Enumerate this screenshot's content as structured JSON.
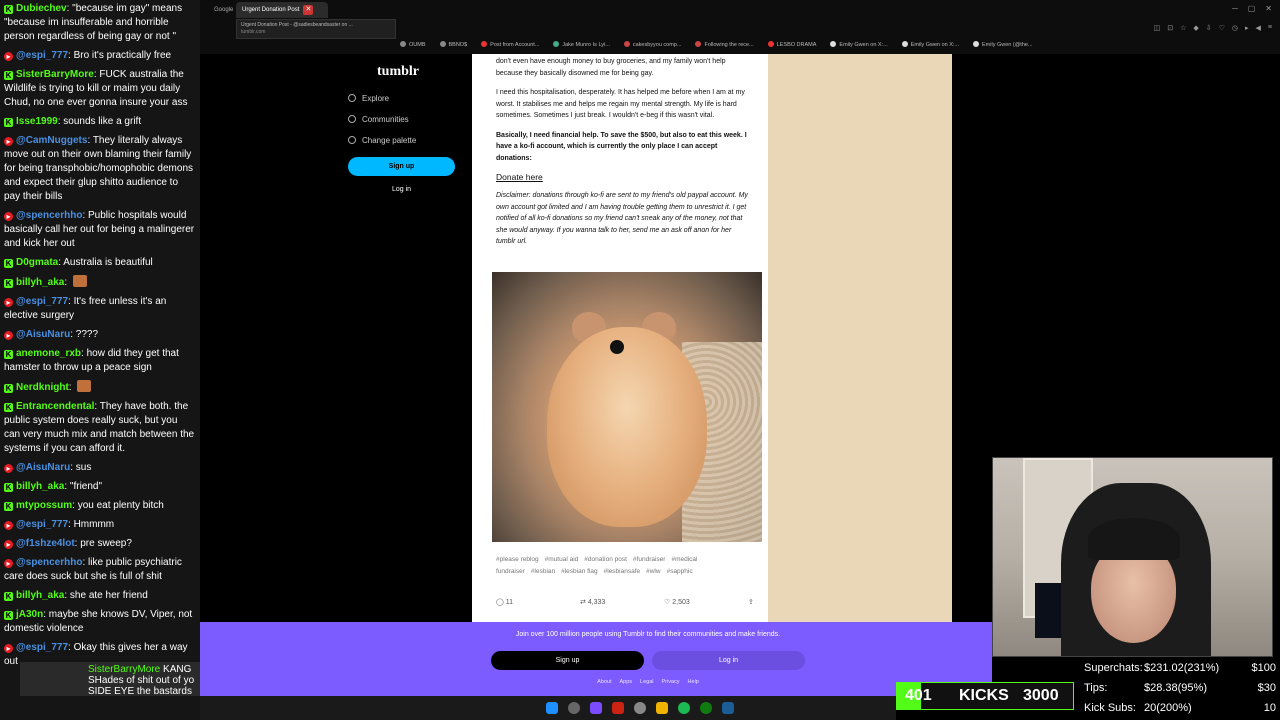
{
  "chat": {
    "messages": [
      {
        "platform": "kick",
        "user": "Dubiechev",
        "text": "\"because im gay\" means \"because im insufferable and horrible person regardless of being gay or not \""
      },
      {
        "platform": "yt",
        "user": "@espi_777",
        "text": "Bro it's practically free"
      },
      {
        "platform": "kick",
        "user": "SisterBarryMore",
        "text": "FUCK australia the Wildlife is trying to kill or maim you daily Chud, no one ever gonna insure your ass"
      },
      {
        "platform": "kick",
        "user": "Isse1999",
        "text": "sounds like a grift"
      },
      {
        "platform": "yt",
        "user": "@CamNuggets",
        "text": "They literally always move out on their own blaming their family for being transphobic/homophobic demons and expect their glup shitto audience to pay their bills"
      },
      {
        "platform": "yt",
        "user": "@spencerhho",
        "text": "Public hospitals would basically call her out for being a malingerer and kick her out"
      },
      {
        "platform": "kick",
        "user": "D0gmata",
        "text": "Australia is beautiful"
      },
      {
        "platform": "kick",
        "user": "billyh_aka",
        "text": "",
        "emote": true
      },
      {
        "platform": "yt",
        "user": "@espi_777",
        "text": "It's free unless it's an elective surgery"
      },
      {
        "platform": "yt",
        "user": "@AisuNaru",
        "text": "????"
      },
      {
        "platform": "kick",
        "user": "anemone_rxb",
        "text": "how did they get that hamster to throw up a peace sign"
      },
      {
        "platform": "kick",
        "user": "Nerdknight",
        "text": "",
        "emote": true
      },
      {
        "platform": "kick",
        "user": "Entrancendental",
        "text": "They have both. the public system does really suck, but you can very much mix and match between the systems if you can afford it."
      },
      {
        "platform": "yt",
        "user": "@AisuNaru",
        "text": "sus"
      },
      {
        "platform": "kick",
        "user": "billyh_aka",
        "text": "\"friend\""
      },
      {
        "platform": "kick",
        "user": "mtypossum",
        "text": "you eat plenty bitch"
      },
      {
        "platform": "yt",
        "user": "@espi_777",
        "text": "Hmmmm"
      },
      {
        "platform": "yt",
        "user": "@f1shze4lot",
        "text": "pre sweep?"
      },
      {
        "platform": "yt",
        "user": "@spencerhho",
        "text": "like public psychiatric care does suck but she is full of shit"
      },
      {
        "platform": "kick",
        "user": "billyh_aka",
        "text": "she ate her friend"
      },
      {
        "platform": "kick",
        "user": "jA30n",
        "text": "maybe she knows DV, Viper, not domestic violence"
      },
      {
        "platform": "yt",
        "user": "@espi_777",
        "text": "Okay this gives her a way out"
      }
    ],
    "pinned": {
      "user": "SisterBarryMore",
      "suffix": "KANG",
      "line2": "SHades of shit out of yo",
      "line3": "SIDE EYE the bastards"
    }
  },
  "browser": {
    "tabs": [
      {
        "label": "Google",
        "active": false
      },
      {
        "label": "Urgent Donation Post",
        "active": true
      }
    ],
    "tooltip": {
      "title": "Urgent Donation Post - @sadiesbeandsaster on ...",
      "url": "tumblr.com"
    },
    "bookmarks": [
      "OUMB",
      "BBNO$",
      "Post from Account...",
      "Jake Munro Is Lyi...",
      "cakesbyyou comp...",
      "Following the rece...",
      "LESBO DRAMA",
      "Emily Gwen on X:...",
      "Emily Gwen on X:...",
      "Emily Gwen (@the..."
    ]
  },
  "tumblr": {
    "logo": "tumblr",
    "nav": [
      "Explore",
      "Communities",
      "Change palette"
    ],
    "signup": "Sign up",
    "login": "Log in"
  },
  "post": {
    "p1": "don't even have enough money to buy groceries, and my family won't help because they basically disowned me for being gay.",
    "p2": "I need this hospitalisation, desperately. It has helped me before when I am at my worst. It stabilises me and helps me regain my mental strength. My life is hard sometimes. Sometimes I just break. I wouldn't e-beg if this wasn't vital.",
    "p3": "Basically, I need financial help. To save the $500, but also to eat this week. I have a ko-fi account, which is currently the only place I can accept donations:",
    "donate": "Donate here",
    "p4": "Disclaimer: donations through ko-fi are sent to my friend's old paypal account. My own account got limited and I am having trouble getting them to unrestrict it. I get notified of all ko-fi donations so my friend can't sneak any of the money, not that she would anyway. If you wanna talk to her, send me an ask off anon for her tumblr url.",
    "tags": [
      "#please reblog",
      "#mutual aid",
      "#donation post",
      "#fundraiser",
      "#medical fundraiser",
      "#lesbian",
      "#lesbian flag",
      "#lesbiansafe",
      "#wlw",
      "#sapphic"
    ],
    "replies": "11",
    "reblogs": "4,333",
    "likes": "2,503"
  },
  "banner": {
    "text": "Join over 100 million people using Tumblr to find their communities and make friends.",
    "signup": "Sign up",
    "login": "Log in",
    "links": [
      "About",
      "Apps",
      "Legal",
      "Privacy",
      "Help"
    ]
  },
  "stats": {
    "superchats": {
      "label": "Superchats:",
      "value": "$231.02(231%)",
      "goal": "$100"
    },
    "tips": {
      "label": "Tips:",
      "value": "$28.38(95%)",
      "goal": "$30"
    },
    "kick_subs": {
      "label": "Kick Subs:",
      "value": "20(200%)",
      "goal": "10"
    }
  },
  "kicks": {
    "count": "401",
    "label": "KICKS",
    "goal": "3000",
    "progress": 0.134
  },
  "colors": {
    "kick": "#53fc18",
    "youtube": "#e31b23",
    "tumblr_banner": "#7c5cff",
    "tumblr_blue": "#00b8ff"
  }
}
